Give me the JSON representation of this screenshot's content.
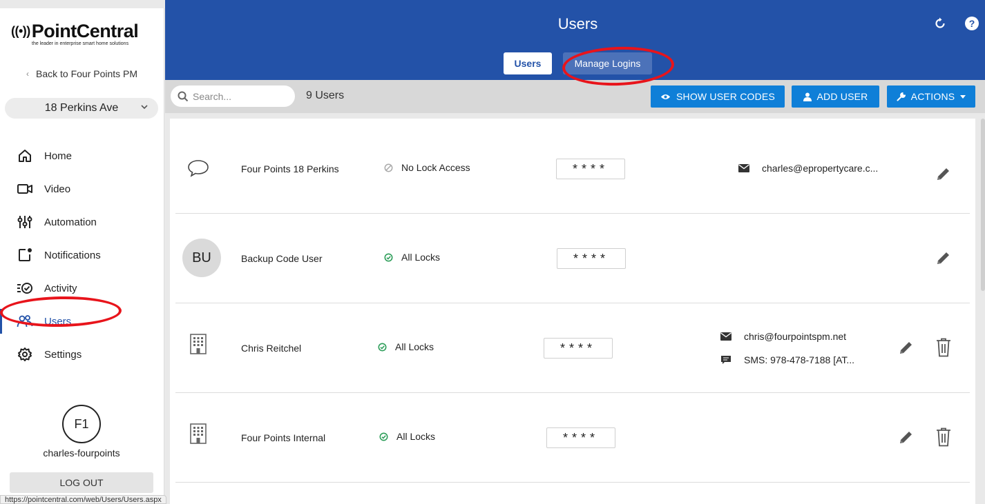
{
  "brand": {
    "name": "PointCentral",
    "tagline": "the leader in enterprise smart home solutions"
  },
  "sidebar": {
    "back_label": "Back to Four Points PM",
    "property": "18 Perkins Ave",
    "items": [
      {
        "label": "Home",
        "icon": "home-icon"
      },
      {
        "label": "Video",
        "icon": "video-camera-icon"
      },
      {
        "label": "Automation",
        "icon": "sliders-icon"
      },
      {
        "label": "Notifications",
        "icon": "notification-icon"
      },
      {
        "label": "Activity",
        "icon": "activity-icon"
      },
      {
        "label": "Users",
        "icon": "users-icon",
        "active": true
      },
      {
        "label": "Settings",
        "icon": "gear-icon"
      }
    ],
    "user_initials": "F1",
    "username": "charles-fourpoints",
    "logout_label": "LOG OUT"
  },
  "header": {
    "title": "Users",
    "tabs": [
      {
        "label": "Users",
        "active": true
      },
      {
        "label": "Manage Logins",
        "active": false
      }
    ]
  },
  "toolbar": {
    "search_placeholder": "Search...",
    "user_count": "9 Users",
    "show_codes_label": "SHOW USER CODES",
    "add_user_label": "ADD USER",
    "actions_label": "ACTIONS"
  },
  "users": [
    {
      "name": "Four Points 18 Perkins",
      "icon": "chat-bubble-icon",
      "access": "No Lock Access",
      "access_status": "none",
      "code": "****",
      "email": "charles@epropertycare.c...",
      "sms": "",
      "can_delete": false
    },
    {
      "name": "Backup Code User",
      "icon": "initials",
      "initials": "BU",
      "access": "All Locks",
      "access_status": "ok",
      "code": "****",
      "email": "",
      "sms": "",
      "can_delete": false
    },
    {
      "name": "Chris Reitchel",
      "icon": "building-icon",
      "access": "All Locks",
      "access_status": "ok",
      "code": "****",
      "email": "chris@fourpointspm.net",
      "sms": "SMS: 978-478-7188 [AT...",
      "can_delete": true
    },
    {
      "name": "Four Points Internal",
      "icon": "building-icon",
      "access": "All Locks",
      "access_status": "ok",
      "code": "****",
      "email": "",
      "sms": "",
      "can_delete": true
    }
  ],
  "status_bar": {
    "url": "https://pointcentral.com/web/Users/Users.aspx"
  },
  "colors": {
    "header_blue": "#2352a8",
    "button_blue": "#0f7fd8",
    "annotation_red": "#e8141b",
    "check_green": "#2e9e5a"
  }
}
